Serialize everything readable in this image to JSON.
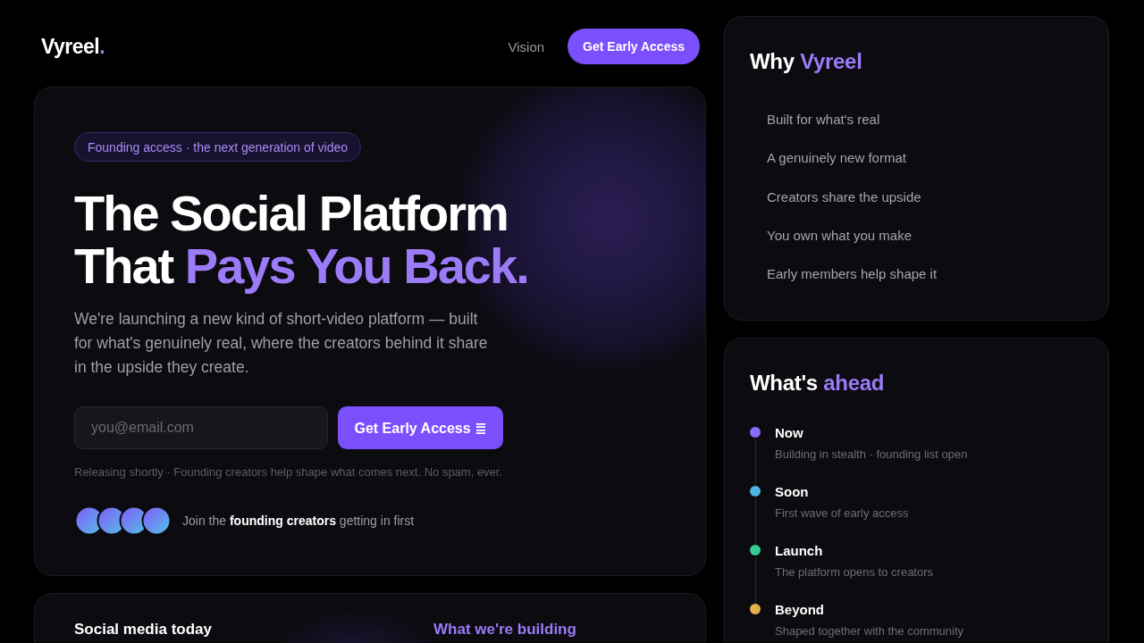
{
  "header": {
    "logo": {
      "name": "Vyreel",
      "dot": "."
    },
    "nav_links": [
      "Vision"
    ],
    "cta_button": "Get Early Access"
  },
  "hero": {
    "badge": "Founding access · the next generation of video",
    "headline": {
      "line_1": "The Social Platform",
      "line_2": "That",
      "line_2_highlight": "Pays You Back."
    },
    "description": "We're launching a new kind of short-video platform — built for what's genuinely real, where the creators behind it share in the upside they create.",
    "email_field": {
      "placeholder": "you@email.com"
    },
    "submit_button": "Get Early Access ≣",
    "note": "Releasing shortly · Founding creators help shape what comes next. No spam, ever.",
    "social_proof": "Join the **founding creators** getting in first"
  },
  "comparison": {
    "columns": [
      {
        "title": "Social media today",
        "highlight": false
      },
      {
        "title": "What we're building",
        "highlight": true
      }
    ]
  },
  "why_card": {
    "title": {
      "text": "Why",
      "highlight": "Vyreel"
    },
    "items": [
      "Built for what's real",
      "A genuinely new format",
      "Creators share the upside",
      "You own what you make",
      "Early members help shape it"
    ]
  },
  "roadmap_card": {
    "title": {
      "text": "What's",
      "highlight": "ahead"
    },
    "items": [
      {
        "label": "Now",
        "description": "Building in stealth · founding list open",
        "color": "#8b6cf6"
      },
      {
        "label": "Soon",
        "description": "First wave of early access",
        "color": "#4fb3e3"
      },
      {
        "label": "Launch",
        "description": "The platform opens to creators",
        "color": "#34cc94"
      },
      {
        "label": "Beyond",
        "description": "Shaped together with the community",
        "color": "#e3b04b"
      }
    ]
  }
}
